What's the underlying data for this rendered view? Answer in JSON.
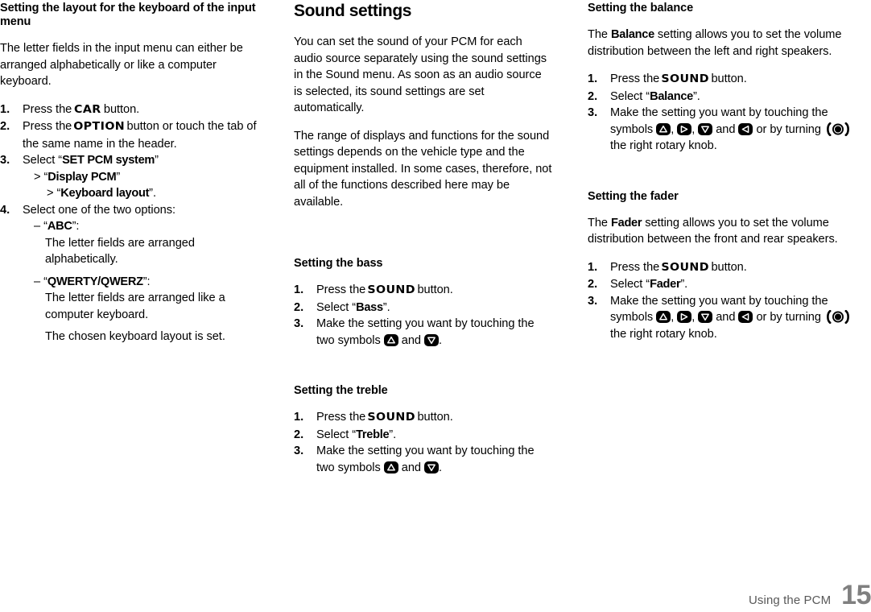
{
  "footer": {
    "label": "Using the PCM",
    "page_number": "15"
  },
  "column1": {
    "heading": "Setting the layout for the keyboard of the input menu",
    "intro": "The letter fields in the input menu can either be arranged alphabetically or like a computer keyboard.",
    "steps": [
      {
        "num": "1.",
        "pre": "Press the ",
        "button": "CAR",
        "post": " button."
      },
      {
        "num": "2.",
        "pre": "Press the ",
        "button": "OPTION",
        "post": " button or touch the tab of the same name in the header."
      },
      {
        "num": "3.",
        "pre": "Select “",
        "bold": "SET PCM system",
        "post": "”",
        "sub1_chevron": "> “",
        "sub1_bold": "Display PCM",
        "sub1_post": "”",
        "sub2_chevron": "> “",
        "sub2_bold": "Keyboard layout",
        "sub2_post": "”."
      },
      {
        "num": "4.",
        "pre": "Select one of the two options:",
        "opt1_dash": "– “",
        "opt1_bold": "ABC",
        "opt1_post": "”:",
        "opt1_desc": "The letter fields are arranged alphabetically.",
        "opt2_dash": "– “",
        "opt2_bold": "QWERTY/QWERZ",
        "opt2_post": "”:",
        "opt2_desc": "The letter fields are arranged like a computer keyboard.",
        "result": "The chosen keyboard layout is set."
      }
    ]
  },
  "column2": {
    "heading": "Sound settings",
    "para1": "You can set the sound of your PCM for each audio source separately using the sound settings in the Sound menu. As soon as an audio source is selected, its sound settings are set automatically.",
    "para2": "The range of displays and functions for the sound settings depends on the vehicle type and the equipment installed. In some cases, therefore, not all of the functions described here may be available.",
    "bass": {
      "heading": "Setting the bass",
      "step1_num": "1.",
      "step1_pre": "Press the ",
      "step1_button": "SOUND",
      "step1_post": " button.",
      "step2_num": "2.",
      "step2_pre": "Select “",
      "step2_bold": "Bass",
      "step2_post": "”.",
      "step3_num": "3.",
      "step3_pre": "Make the setting you want by touching the two symbols ",
      "step3_mid": " and ",
      "step3_post": "."
    },
    "treble": {
      "heading": "Setting the treble",
      "step1_num": "1.",
      "step1_pre": "Press the ",
      "step1_button": "SOUND",
      "step1_post": " button.",
      "step2_num": "2.",
      "step2_pre": "Select “",
      "step2_bold": "Treble",
      "step2_post": "”.",
      "step3_num": "3.",
      "step3_pre": "Make the setting you want by touching the two symbols ",
      "step3_mid": " and ",
      "step3_post": "."
    }
  },
  "column3": {
    "balance": {
      "heading": "Setting the balance",
      "intro_pre": "The ",
      "intro_bold": "Balance",
      "intro_post": " setting allows you to set the volume distribution between the left and right speakers.",
      "step1_num": "1.",
      "step1_pre": "Press the ",
      "step1_button": "SOUND",
      "step1_post": " button.",
      "step2_num": "2.",
      "step2_pre": "Select “",
      "step2_bold": "Balance",
      "step2_post": "”.",
      "step3_num": "3.",
      "step3_pre": "Make the setting you want by touching the symbols ",
      "step3_sep1": ", ",
      "step3_sep2": ", ",
      "step3_and": " and ",
      "step3_turn": " or by turning ",
      "step3_post": " the right rotary knob."
    },
    "fader": {
      "heading": "Setting the fader",
      "intro_pre": "The ",
      "intro_bold": "Fader",
      "intro_post": " setting allows you to set the volume distribution between the front and rear speakers.",
      "step1_num": "1.",
      "step1_pre": "Press the ",
      "step1_button": "SOUND",
      "step1_post": " button.",
      "step2_num": "2.",
      "step2_pre": "Select “",
      "step2_bold": "Fader",
      "step2_post": "”.",
      "step3_num": "3.",
      "step3_pre": "Make the setting you want by touching the symbols ",
      "step3_sep1": ", ",
      "step3_sep2": ", ",
      "step3_and": " and ",
      "step3_turn": " or by turning ",
      "step3_post": " the right rotary knob."
    }
  },
  "icons": {
    "up": "arrow-up-icon",
    "down": "arrow-down-icon",
    "left": "arrow-left-icon",
    "right": "arrow-right-icon",
    "knob": "rotary-knob-icon"
  }
}
